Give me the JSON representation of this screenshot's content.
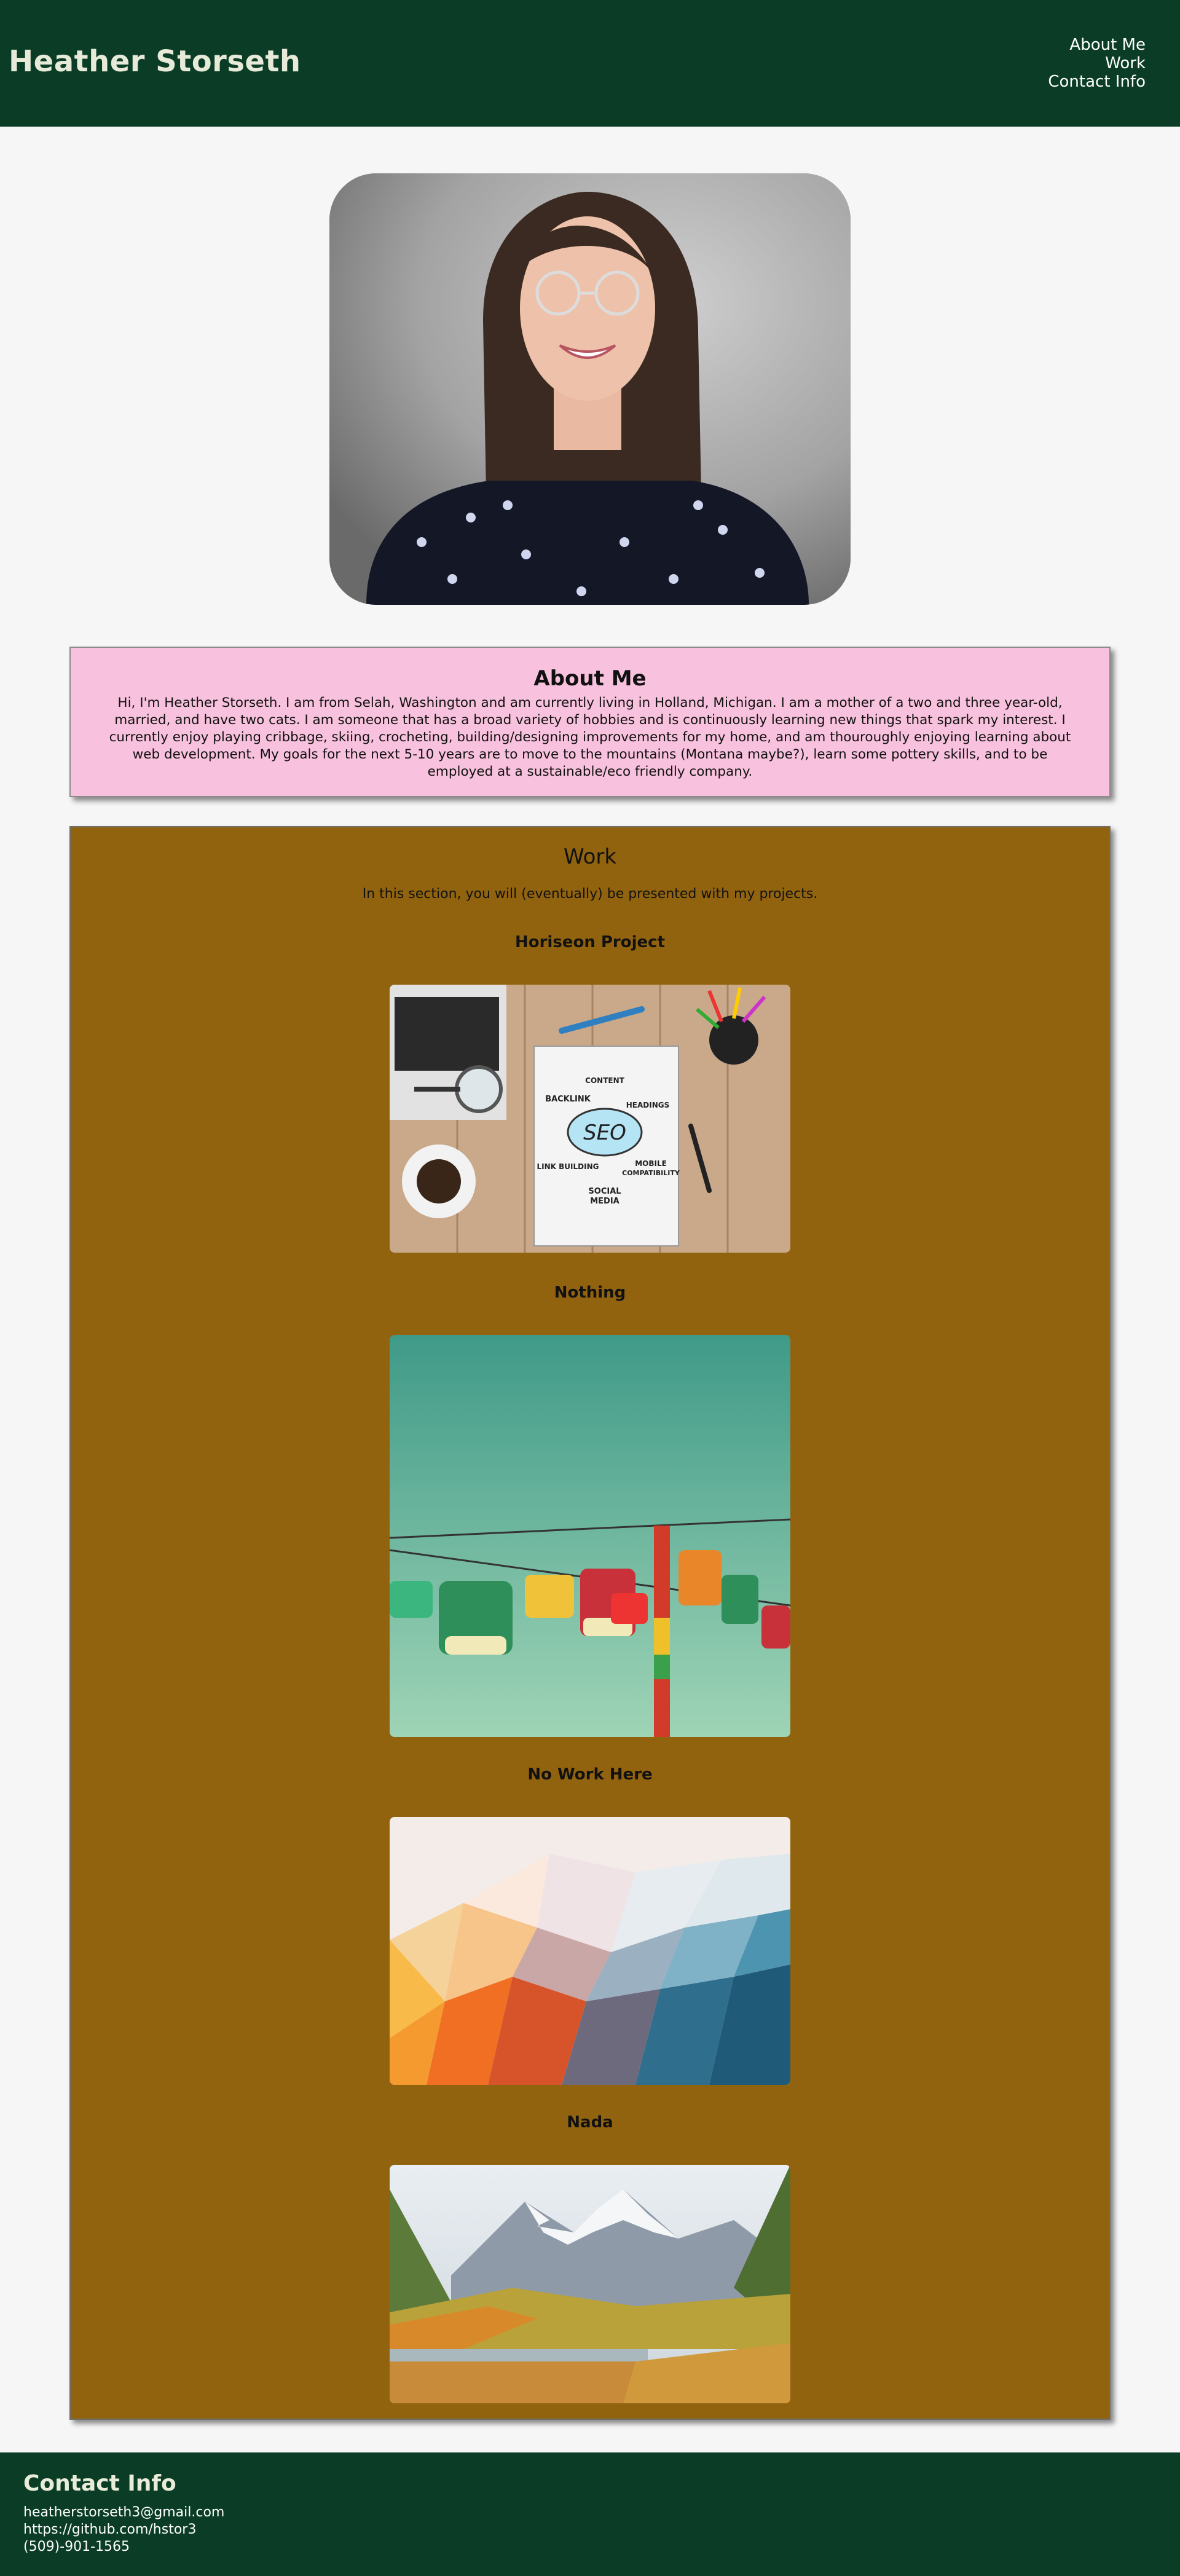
{
  "header": {
    "title": "Heather Storseth",
    "nav": [
      "About Me",
      "Work",
      "Contact Info"
    ]
  },
  "profile": {
    "photo_description_icon": "portrait-photo"
  },
  "about": {
    "title": "About Me",
    "text": "Hi, I'm Heather Storseth. I am from Selah, Washington and am currently living in Holland, Michigan. I am a mother of a two and three year-old, married, and have two cats. I am someone that has a broad variety of hobbies and is continuously learning new things that spark my interest. I currently enjoy playing cribbage, skiing, crocheting, building/designing improvements for my home, and am thouroughly enjoying learning about web development. My goals for the next 5-10 years are to move to the mountains (Montana maybe?), learn some pottery skills, and to be employed at a sustainable/eco friendly company."
  },
  "work": {
    "title": "Work",
    "intro": "In this section, you will (eventually) be presented with my projects.",
    "projects": [
      {
        "title": "Horiseon Project",
        "seo": {
          "center": "SEO",
          "labels": [
            "CONTENT",
            "BACKLINK",
            "HEADINGS",
            "LINK BUILDING",
            "MOBILE",
            "COMPATIBILITY",
            "SOCIAL",
            "MEDIA"
          ]
        }
      },
      {
        "title": "Nothing"
      },
      {
        "title": "No Work Here"
      },
      {
        "title": "Nada"
      }
    ]
  },
  "contact": {
    "title": "Contact Info",
    "email": "heatherstorseth3@gmail.com",
    "github": "https://github.com/hstor3",
    "phone": "(509)-901-1565"
  },
  "colors": {
    "header_bg": "#0b3d26",
    "about_bg": "#f8c1dd",
    "work_bg": "#91630f",
    "page_bg": "#f6f6f6"
  }
}
